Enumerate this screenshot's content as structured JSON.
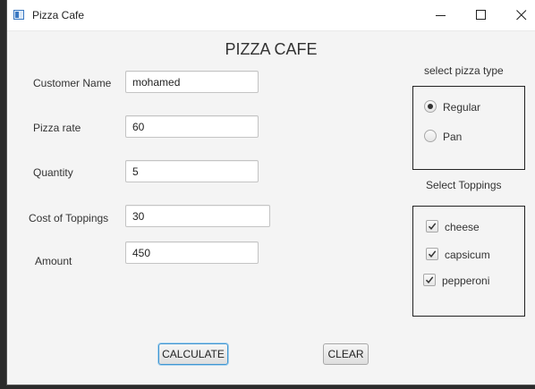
{
  "window": {
    "title": "Pizza Cafe"
  },
  "heading": "PIZZA CAFE",
  "form": {
    "customer_name": {
      "label": "Customer Name",
      "value": "mohamed"
    },
    "pizza_rate": {
      "label": "Pizza rate",
      "value": "60"
    },
    "quantity": {
      "label": "Quantity",
      "value": "5"
    },
    "cost_of_toppings": {
      "label": "Cost of Toppings",
      "value": "30"
    },
    "amount": {
      "label": "Amount",
      "value": "450"
    }
  },
  "pizza_type": {
    "caption": "select pizza type",
    "options": [
      {
        "label": "Regular",
        "selected": true
      },
      {
        "label": "Pan",
        "selected": false
      }
    ]
  },
  "toppings": {
    "caption": "Select Toppings",
    "options": [
      {
        "label": "cheese",
        "checked": true
      },
      {
        "label": "capsicum",
        "checked": true
      },
      {
        "label": "pepperoni",
        "checked": true
      }
    ]
  },
  "buttons": {
    "calculate": "CALCULATE",
    "clear": "CLEAR"
  },
  "icons": {
    "app": "app-window-icon",
    "minimize": "minimize-icon",
    "maximize": "maximize-icon",
    "close": "close-icon",
    "check": "checkmark-icon"
  },
  "colors": {
    "window_bg": "#f4f4f4",
    "titlebar_bg": "#ffffff",
    "focus_ring": "#3f95d1"
  }
}
